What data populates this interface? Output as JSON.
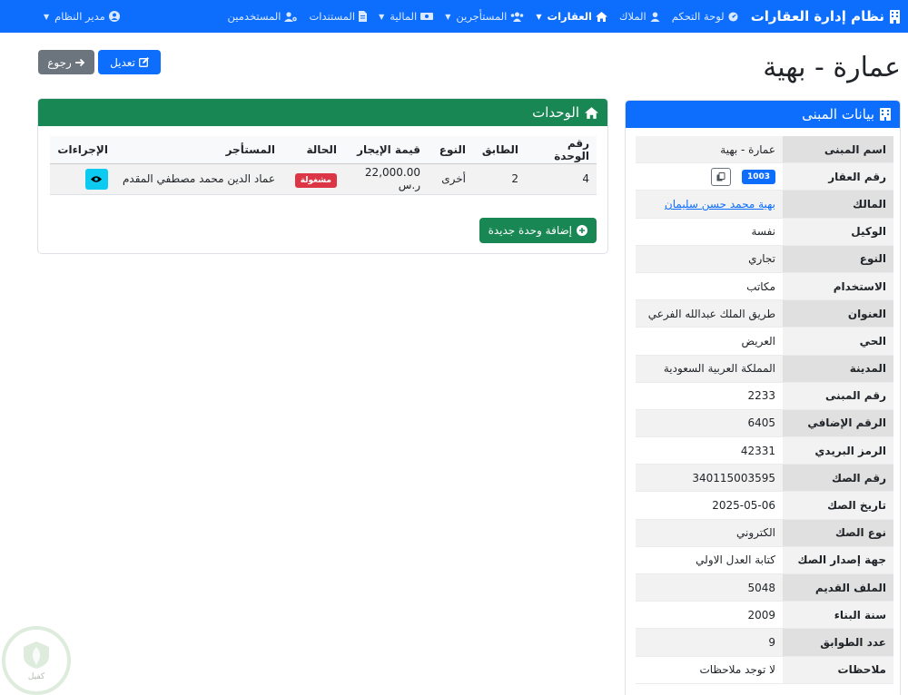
{
  "nav": {
    "brand": "نظام إدارة العقارات",
    "items": [
      {
        "label": "لوحة التحكم",
        "icon": "dashboard-icon"
      },
      {
        "label": "الملاك",
        "icon": "user-icon"
      },
      {
        "label": "العقارات",
        "icon": "home-icon",
        "active": true,
        "dropdown": true
      },
      {
        "label": "المستأجرين",
        "icon": "users-icon",
        "dropdown": true
      },
      {
        "label": "المالية",
        "icon": "money-icon",
        "dropdown": true
      },
      {
        "label": "المستندات",
        "icon": "file-icon"
      },
      {
        "label": "المستخدمين",
        "icon": "user-gear-icon"
      }
    ],
    "user": "مدير النظام"
  },
  "page": {
    "title": "عمارة - بهية",
    "back_label": "رجوع",
    "edit_label": "تعديل"
  },
  "building": {
    "header": "بيانات المبنى",
    "rows": [
      {
        "label": "اسم المبنى",
        "value": "عمارة - بهية"
      },
      {
        "label": "رقم العقار",
        "value": "1003"
      },
      {
        "label": "المالك",
        "value": "بهية محمد حسن سليمان"
      },
      {
        "label": "الوكيل",
        "value": "نفسة"
      },
      {
        "label": "النوع",
        "value": "تجاري"
      },
      {
        "label": "الاستخدام",
        "value": "مكاتب"
      },
      {
        "label": "العنوان",
        "value": "طريق الملك عبدالله الفرعي"
      },
      {
        "label": "الحي",
        "value": "العريض"
      },
      {
        "label": "المدينة",
        "value": "المملكة العربية السعودية"
      },
      {
        "label": "رقم المبنى",
        "value": "2233"
      },
      {
        "label": "الرقم الإضافي",
        "value": "6405"
      },
      {
        "label": "الرمز البريدي",
        "value": "42331"
      },
      {
        "label": "رقم الصك",
        "value": "340115003595"
      },
      {
        "label": "تاريخ الصك",
        "value": "2025-05-06"
      },
      {
        "label": "نوع الصك",
        "value": "الكتروني"
      },
      {
        "label": "جهة إصدار الصك",
        "value": "كتابة العدل الاولي"
      },
      {
        "label": "الملف القديم",
        "value": "5048"
      },
      {
        "label": "سنة البناء",
        "value": "2009"
      },
      {
        "label": "عدد الطوابق",
        "value": "9"
      },
      {
        "label": "ملاحظات",
        "value": "لا توجد ملاحظات"
      }
    ]
  },
  "units": {
    "header": "الوحدات",
    "columns": [
      "رقم الوحدة",
      "الطابق",
      "النوع",
      "قيمة الإيجار",
      "الحالة",
      "المستأجر",
      "الإجراءات"
    ],
    "rows": [
      {
        "unit": "4",
        "floor": "2",
        "type": "أخرى",
        "rent": "22,000.00 ر.س",
        "status": "مشغولة",
        "tenant": "عماد الدين محمد مصطفي المقدم"
      }
    ],
    "add_label": "إضافة وحدة جديدة"
  },
  "logo": {
    "text": "كفيل"
  },
  "colors": {
    "primary": "#0d6efd",
    "success": "#198754",
    "danger": "#dc3545",
    "info": "#0dcaf0",
    "secondary": "#6c757d"
  }
}
